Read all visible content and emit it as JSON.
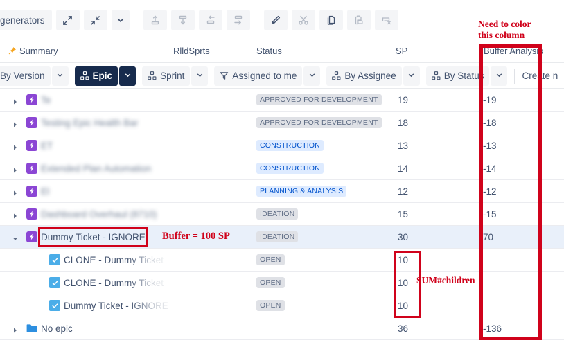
{
  "toolbar": {
    "tab_label": "generators",
    "buttons": [
      {
        "name": "expand-all-icon",
        "title": "Expand all"
      },
      {
        "name": "collapse-all-icon",
        "title": "Collapse all"
      },
      {
        "name": "chevron-down-icon",
        "title": "More"
      },
      {
        "name": "move-up-icon",
        "title": "Move up"
      },
      {
        "name": "move-down-icon",
        "title": "Move down"
      },
      {
        "name": "outdent-icon",
        "title": "Outdent"
      },
      {
        "name": "indent-icon",
        "title": "Indent"
      },
      {
        "name": "edit-pencil-icon",
        "title": "Edit"
      },
      {
        "name": "cut-scissors-icon",
        "title": "Cut"
      },
      {
        "name": "copy-icon",
        "title": "Copy"
      },
      {
        "name": "paste-icon",
        "title": "Paste"
      },
      {
        "name": "delete-icon",
        "title": "Delete"
      }
    ]
  },
  "columns": {
    "summary": "Summary",
    "rlld_sprts": "RlldSprts",
    "status": "Status",
    "sp": "SP",
    "buffer_analysis": "Buffer Analysis"
  },
  "filters": [
    {
      "label": "By Version",
      "icon": "none",
      "active": false,
      "caret": true
    },
    {
      "label": "Epic",
      "icon": "structure-icon",
      "active": true,
      "caret": true
    },
    {
      "label": "Sprint",
      "icon": "structure-icon",
      "active": false,
      "caret": true
    },
    {
      "label": "Assigned to me",
      "icon": "filter-funnel-icon",
      "active": false,
      "caret": true
    },
    {
      "label": "By Assignee",
      "icon": "structure-icon",
      "active": false,
      "caret": true
    },
    {
      "label": "By Status",
      "icon": "structure-icon",
      "active": false,
      "caret": true
    }
  ],
  "create_label": "Create n",
  "rows": [
    {
      "type": "epic",
      "indent": 0,
      "twisty": "collapsed",
      "summary": "Te",
      "blurred": true,
      "status": "APPROVED FOR DEVELOPMENT",
      "status_color": "gray",
      "sp": "19",
      "buffer": "-19",
      "selected": false
    },
    {
      "type": "epic",
      "indent": 0,
      "twisty": "collapsed",
      "summary": "Testing Epic Health Bar",
      "blurred": true,
      "status": "APPROVED FOR DEVELOPMENT",
      "status_color": "gray",
      "sp": "18",
      "buffer": "-18",
      "selected": false
    },
    {
      "type": "epic",
      "indent": 0,
      "twisty": "collapsed",
      "summary": "ET",
      "blurred": true,
      "status": "CONSTRUCTION",
      "status_color": "blue",
      "sp": "13",
      "buffer": "-13",
      "selected": false
    },
    {
      "type": "epic",
      "indent": 0,
      "twisty": "collapsed",
      "summary": "Extended Plan Automation",
      "blurred": true,
      "status": "CONSTRUCTION",
      "status_color": "blue",
      "sp": "14",
      "buffer": "-14",
      "selected": false
    },
    {
      "type": "epic",
      "indent": 0,
      "twisty": "collapsed",
      "summary": "El",
      "blurred": true,
      "status": "PLANNING & ANALYSIS",
      "status_color": "blue",
      "sp": "12",
      "buffer": "-12",
      "selected": false
    },
    {
      "type": "epic",
      "indent": 0,
      "twisty": "collapsed",
      "summary": "Dashboard Overhaul (8710)",
      "blurred": true,
      "status": "IDEATION",
      "status_color": "gray",
      "sp": "15",
      "buffer": "-15",
      "selected": false
    },
    {
      "type": "epic",
      "indent": 0,
      "twisty": "expanded",
      "summary": "Dummy Ticket - IGNORE",
      "blurred": false,
      "status": "IDEATION",
      "status_color": "gray",
      "sp": "30",
      "buffer": "70",
      "selected": true
    },
    {
      "type": "task",
      "indent": 1,
      "twisty": "none",
      "summary": "CLONE - Dummy Ticket",
      "blurred": false,
      "status": "OPEN",
      "status_color": "gray",
      "sp": "10",
      "buffer": "",
      "selected": false
    },
    {
      "type": "task",
      "indent": 1,
      "twisty": "none",
      "summary": "CLONE - Dummy Ticket",
      "blurred": false,
      "status": "OPEN",
      "status_color": "gray",
      "sp": "10",
      "buffer": "",
      "selected": false
    },
    {
      "type": "task",
      "indent": 1,
      "twisty": "none",
      "summary": "Dummy Ticket - IGNORE",
      "blurred": false,
      "status": "OPEN",
      "status_color": "gray",
      "sp": "10",
      "buffer": "",
      "selected": false
    },
    {
      "type": "folder",
      "indent": 0,
      "twisty": "collapsed",
      "summary": "No epic",
      "blurred": false,
      "status": "",
      "status_color": "none",
      "sp": "36",
      "buffer": "-136",
      "selected": false
    }
  ],
  "annotations": {
    "need_to_color_line1": "Need to color",
    "need_to_color_line2": "this column",
    "buffer_100": "Buffer = 100 SP",
    "sum_children": "SUM#children",
    "color": "#d0021b"
  }
}
